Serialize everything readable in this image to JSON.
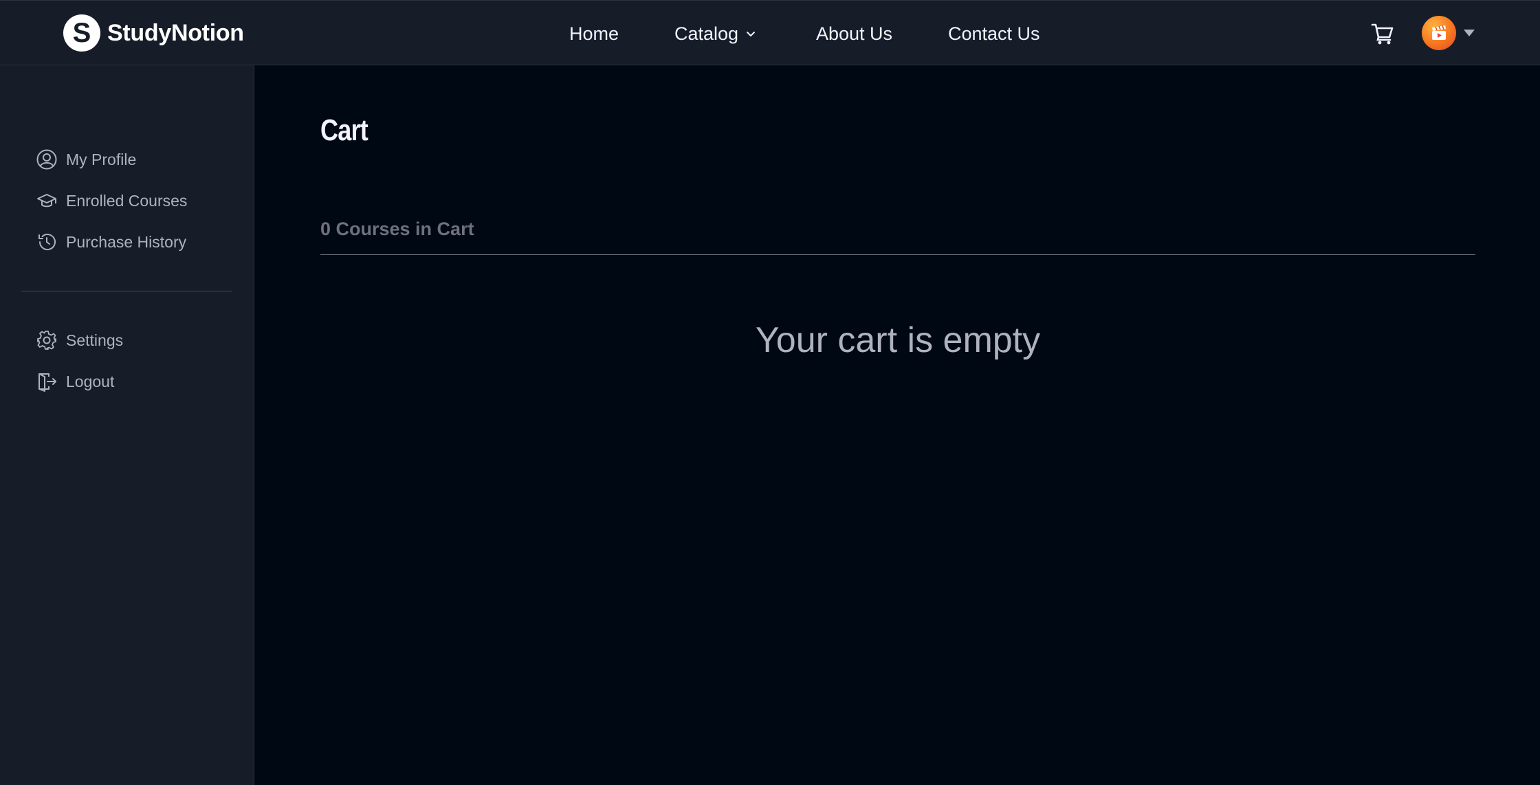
{
  "header": {
    "brand": {
      "mark": "S",
      "name": "StudyNotion"
    },
    "nav": [
      {
        "label": "Home"
      },
      {
        "label": "Catalog",
        "has_dropdown": true
      },
      {
        "label": "About Us"
      },
      {
        "label": "Contact Us"
      }
    ],
    "icons": {
      "cart": "cart-icon",
      "avatar": "avatar",
      "caret": "caret-down-icon"
    }
  },
  "sidebar": {
    "primary": [
      {
        "label": "My Profile",
        "icon": "user-circle-icon"
      },
      {
        "label": "Enrolled Courses",
        "icon": "graduation-cap-icon"
      },
      {
        "label": "Purchase History",
        "icon": "history-icon"
      }
    ],
    "secondary": [
      {
        "label": "Settings",
        "icon": "gear-icon"
      },
      {
        "label": "Logout",
        "icon": "logout-icon"
      }
    ]
  },
  "main": {
    "title": "Cart",
    "count_text": "0 Courses in Cart",
    "empty_message": "Your cart is empty"
  },
  "colors": {
    "page_bg": "#000814",
    "panel_bg": "#161d29",
    "text_primary": "#f1f2ff",
    "text_muted": "#afb2bf",
    "text_dim": "#6e727f",
    "avatar_accent": "#f7751e"
  }
}
